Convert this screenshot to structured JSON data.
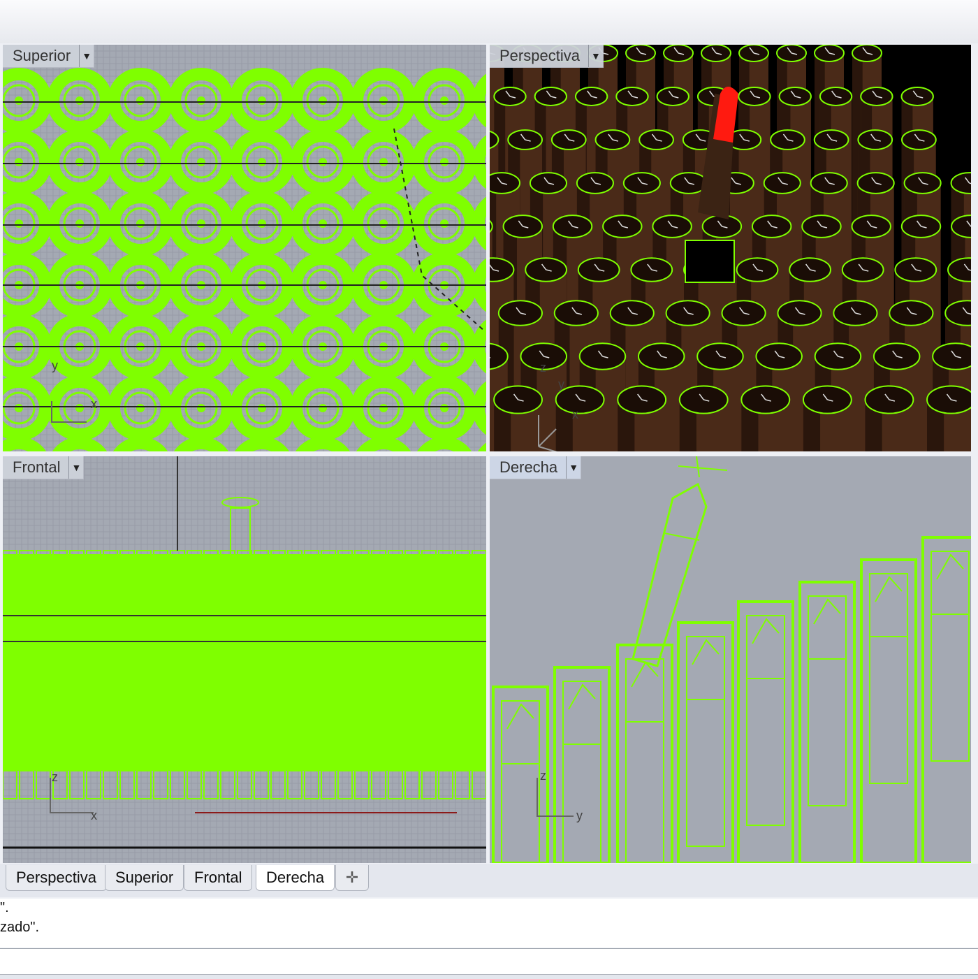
{
  "viewports": {
    "top": {
      "label": "Superior",
      "axis_x": "x",
      "axis_y": "y"
    },
    "perspective": {
      "label": "Perspectiva",
      "axis_x": "x",
      "axis_y": "y",
      "axis_z": "z"
    },
    "front": {
      "label": "Frontal",
      "axis_x": "x",
      "axis_z": "z"
    },
    "right": {
      "label": "Derecha",
      "axis_y": "y",
      "axis_z": "z"
    }
  },
  "tabs": [
    {
      "label": "Perspectiva"
    },
    {
      "label": "Superior"
    },
    {
      "label": "Frontal"
    },
    {
      "label": "Derecha"
    }
  ],
  "tab_add_icon": "plus-icon",
  "dropdown_icon": "dropdown-arrow-icon",
  "command_history": [
    "\".",
    "zado\"."
  ],
  "colors": {
    "wireframe": "#7fff00",
    "viewport_bg": "#a4a9b3",
    "lipstick_body": "#4a2a18",
    "lipstick_tip": "#ff1a10"
  }
}
